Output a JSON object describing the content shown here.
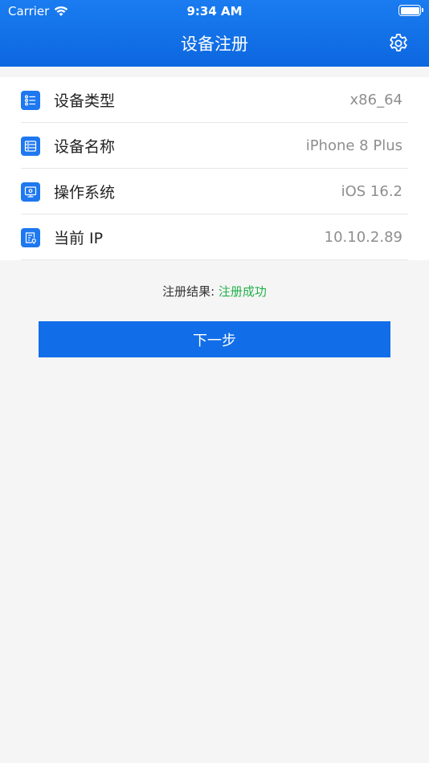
{
  "status_bar": {
    "carrier": "Carrier",
    "time": "9:34 AM"
  },
  "nav": {
    "title": "设备注册",
    "settings_icon": "gear-icon"
  },
  "info_rows": [
    {
      "label": "设备类型",
      "value": "x86_64",
      "icon": "device-type-icon"
    },
    {
      "label": "设备名称",
      "value": "iPhone 8 Plus",
      "icon": "device-name-icon"
    },
    {
      "label": "操作系统",
      "value": "iOS 16.2",
      "icon": "monitor-icon"
    },
    {
      "label": "当前 IP",
      "value": "10.10.2.89",
      "icon": "ip-location-icon"
    }
  ],
  "result": {
    "label": "注册结果:",
    "value": "注册成功"
  },
  "next_button": {
    "label": "下一步"
  },
  "colors": {
    "header_blue": "#0d67e0",
    "button_blue": "#116ee8",
    "success_green": "#22b14c",
    "icon_blue": "#1e78f0"
  }
}
